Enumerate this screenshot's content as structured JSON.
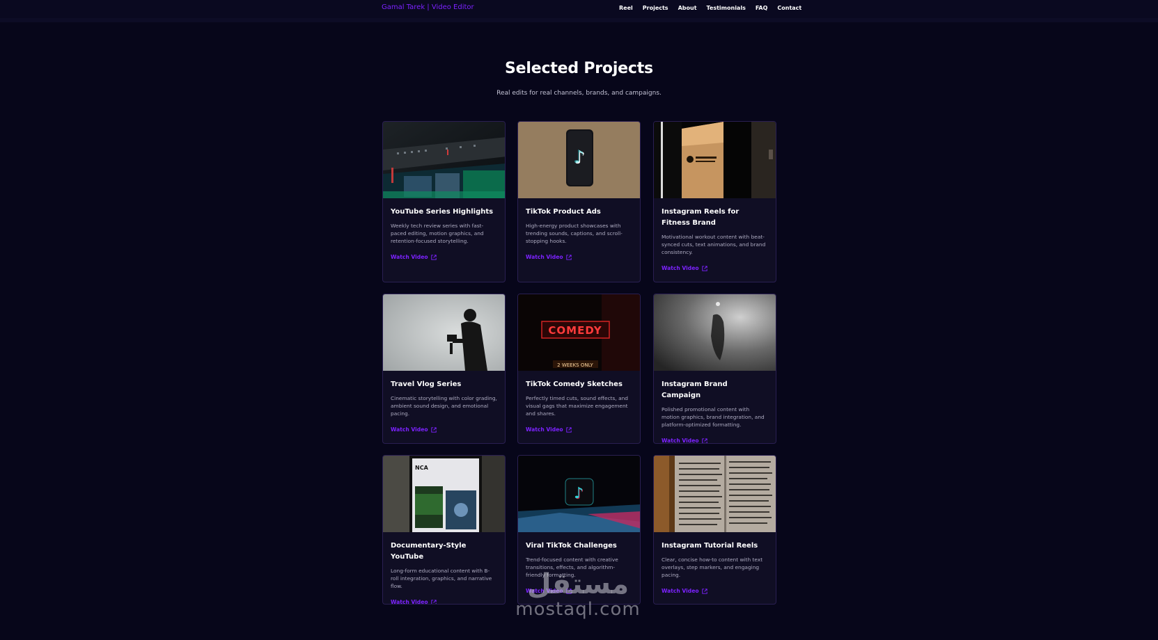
{
  "nav": {
    "brand": "Gamal Tarek | Video Editor",
    "links": [
      "Reel",
      "Projects",
      "About",
      "Testimonials",
      "FAQ",
      "Contact"
    ]
  },
  "section": {
    "title": "Selected Projects",
    "subtitle": "Real edits for real channels, brands, and campaigns."
  },
  "cards": [
    {
      "title": "YouTube Series Highlights",
      "desc": "Weekly tech review series with fast-paced editing, motion graphics, and retention-focused storytelling.",
      "link": "Watch Video",
      "thumb": "editing-timeline-screen"
    },
    {
      "title": "TikTok Product Ads",
      "desc": "High-energy product showcases with trending sounds, captions, and scroll-stopping hooks.",
      "link": "Watch Video",
      "thumb": "phone-tiktok-logo"
    },
    {
      "title": "Instagram Reels for Fitness Brand",
      "desc": "Motivational workout content with beat-synced cuts, text animations, and brand consistency.",
      "link": "Watch Video",
      "thumb": "lit-sign-dark"
    },
    {
      "title": "Travel Vlog Series",
      "desc": "Cinematic storytelling with color grading, ambient sound design, and emotional pacing.",
      "link": "Watch Video",
      "thumb": "camera-silhouette"
    },
    {
      "title": "TikTok Comedy Sketches",
      "desc": "Perfectly timed cuts, sound effects, and visual gags that maximize engagement and shares.",
      "link": "Watch Video",
      "thumb": "neon-comedy-sign"
    },
    {
      "title": "Instagram Brand Campaign",
      "desc": "Polished promotional content with motion graphics, brand integration, and platform-optimized formatting.",
      "link": "Watch Video",
      "thumb": "grey-shadow-object"
    },
    {
      "title": "Documentary-Style YouTube",
      "desc": "Long-form educational content with B-roll integration, graphics, and narrative flow.",
      "link": "Watch Video",
      "thumb": "phone-news-app"
    },
    {
      "title": "Viral TikTok Challenges",
      "desc": "Trend-focused content with creative transitions, effects, and algorithm-friendly formatting.",
      "link": "Watch Video",
      "thumb": "neon-tiktok-cube"
    },
    {
      "title": "Instagram Tutorial Reels",
      "desc": "Clear, concise how-to content with text overlays, step markers, and engaging pacing.",
      "link": "Watch Video",
      "thumb": "open-book-pages"
    }
  ],
  "watermark": {
    "glyph": "مستقل",
    "text": "mostaql.com"
  },
  "colors": {
    "accent": "#7c22ff",
    "background": "#07061a",
    "card": "#100e24",
    "card_border": "#2a1f52"
  }
}
